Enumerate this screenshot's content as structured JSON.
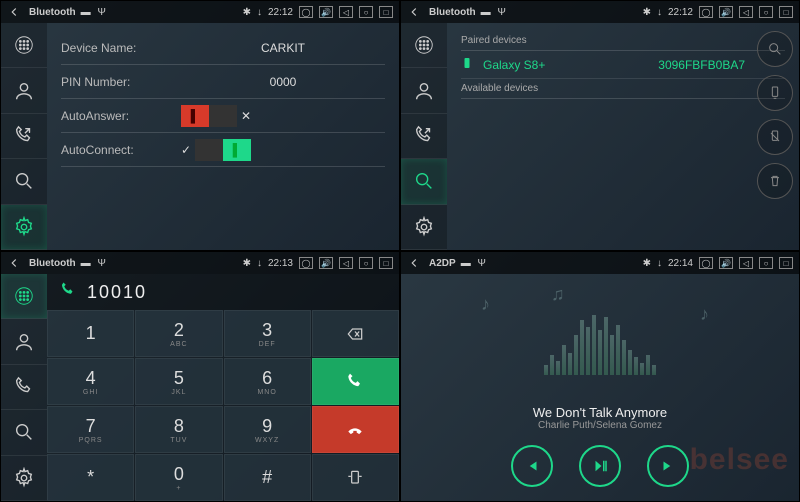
{
  "panes": {
    "settings": {
      "status": {
        "title": "Bluetooth",
        "time": "22:12"
      },
      "rows": {
        "deviceName": {
          "label": "Device Name:",
          "value": "CARKIT"
        },
        "pin": {
          "label": "PIN Number:",
          "value": "0000"
        },
        "autoAnswer": {
          "label": "AutoAnswer:",
          "value": false
        },
        "autoConnect": {
          "label": "AutoConnect:",
          "value": true
        }
      }
    },
    "search": {
      "status": {
        "title": "Bluetooth",
        "time": "22:12"
      },
      "pairedLabel": "Paired devices",
      "availableLabel": "Available devices",
      "device": {
        "name": "Galaxy S8+",
        "mac": "3096FBFB0BA7"
      }
    },
    "dialer": {
      "status": {
        "title": "Bluetooth",
        "time": "22:13"
      },
      "display": "10010",
      "keys": [
        {
          "n": "1",
          "s": ""
        },
        {
          "n": "2",
          "s": "ABC"
        },
        {
          "n": "3",
          "s": "DEF"
        },
        {
          "n": "4",
          "s": "GHI"
        },
        {
          "n": "5",
          "s": "JKL"
        },
        {
          "n": "6",
          "s": "MNO"
        },
        {
          "n": "7",
          "s": "PQRS"
        },
        {
          "n": "8",
          "s": "TUV"
        },
        {
          "n": "9",
          "s": "WXYZ"
        },
        {
          "n": "*",
          "s": ""
        },
        {
          "n": "0",
          "s": "+"
        },
        {
          "n": "#",
          "s": ""
        }
      ]
    },
    "music": {
      "status": {
        "title": "A2DP",
        "time": "22:14"
      },
      "track": "We Don't Talk Anymore",
      "artist": "Charlie Puth/Selena Gomez",
      "watermark": "belsee"
    }
  },
  "icons": {
    "sidebar": [
      "dialpad",
      "contacts",
      "call-log",
      "search",
      "settings"
    ]
  }
}
